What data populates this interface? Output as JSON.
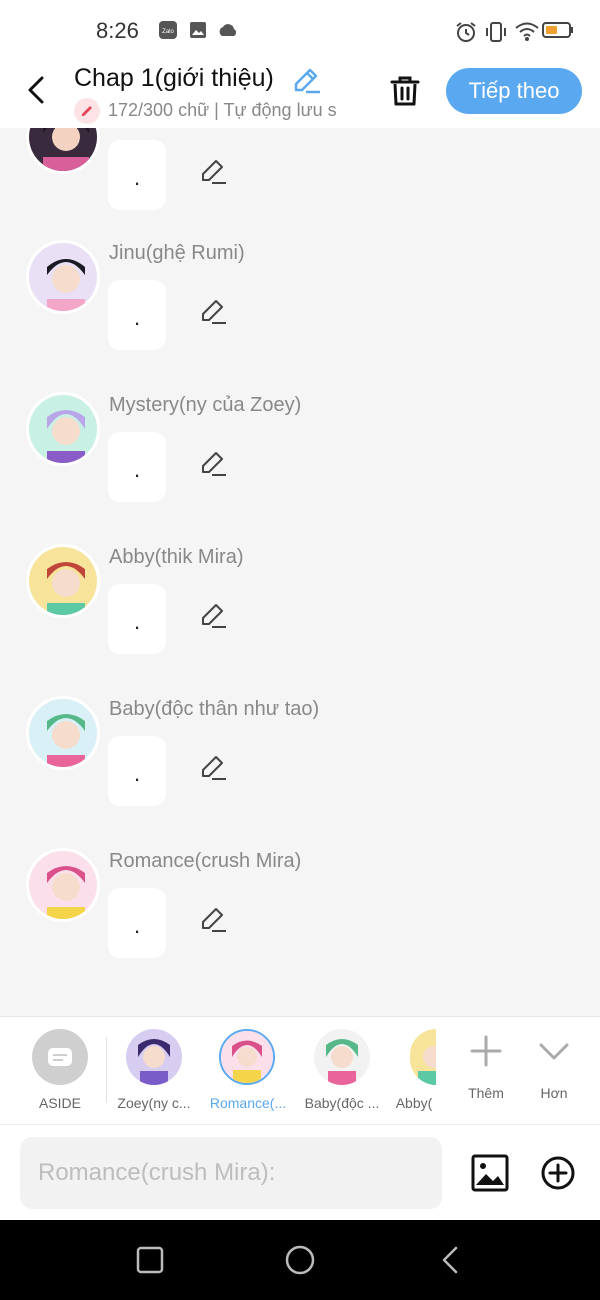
{
  "status_bar": {
    "time": "8:26",
    "left_icons": [
      "zalo-icon",
      "gallery-icon",
      "cloud-icon"
    ],
    "right_icons": [
      "alarm-icon",
      "vibrate-icon",
      "wifi-icon",
      "battery-icon"
    ],
    "zalo_text": "Zalo"
  },
  "header": {
    "title": "Chap 1(giới thiệu)",
    "subtitle": "172/300 chữ | Tự động lưu s",
    "next_label": "Tiếp theo"
  },
  "messages": [
    {
      "name": "",
      "text": "."
    },
    {
      "name": "Jinu(ghệ Rumi)",
      "text": "."
    },
    {
      "name": "Mystery(ny của Zoey)",
      "text": "."
    },
    {
      "name": "Abby(thik Mira)",
      "text": "."
    },
    {
      "name": "Baby(độc thân như tao)",
      "text": "."
    },
    {
      "name": "Romance(crush Mira)",
      "text": "."
    }
  ],
  "tray": {
    "aside_label": "ASIDE",
    "characters": [
      {
        "label": "Zoey(ny c...",
        "selected": false
      },
      {
        "label": "Romance(...",
        "selected": true
      },
      {
        "label": "Baby(độc ...",
        "selected": false
      },
      {
        "label": "Abby(",
        "selected": false
      }
    ],
    "add_label": "Thêm",
    "more_label": "Hơn"
  },
  "input": {
    "placeholder": "Romance(crush Mira):"
  },
  "colors": {
    "accent": "#5aa9f0",
    "background": "#f5f5f5",
    "text_muted": "#888888"
  }
}
